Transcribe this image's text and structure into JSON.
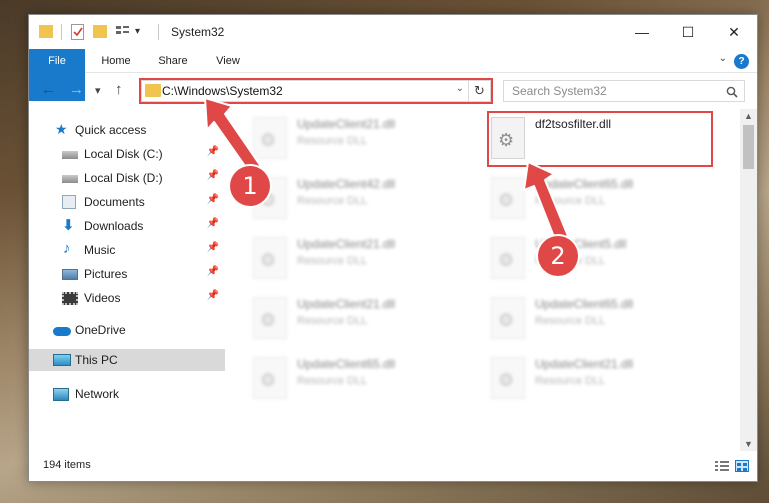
{
  "window": {
    "title": "System32",
    "controls": {
      "minimize": "—",
      "maximize": "☐",
      "close": "✕"
    }
  },
  "ribbon": {
    "tabs": [
      "File",
      "Home",
      "Share",
      "View"
    ],
    "help": "?"
  },
  "nav": {
    "back": "←",
    "forward": "→",
    "recent": "▾",
    "up": "↑"
  },
  "address": {
    "path": "C:\\Windows\\System32",
    "dropdown": "⌄",
    "refresh": "↻"
  },
  "search": {
    "placeholder": "Search System32",
    "icon": "search-icon"
  },
  "sidebar": {
    "items": [
      {
        "label": "Quick access",
        "icon": "star-icon"
      },
      {
        "label": "Local Disk (C:)",
        "icon": "drive-icon",
        "pinned": true
      },
      {
        "label": "Local Disk (D:)",
        "icon": "drive-icon",
        "pinned": true
      },
      {
        "label": "Documents",
        "icon": "documents-icon",
        "pinned": true
      },
      {
        "label": "Downloads",
        "icon": "download-icon",
        "pinned": true
      },
      {
        "label": "Music",
        "icon": "music-icon",
        "pinned": true
      },
      {
        "label": "Pictures",
        "icon": "pictures-icon",
        "pinned": true
      },
      {
        "label": "Videos",
        "icon": "videos-icon",
        "pinned": true
      },
      {
        "label": "OneDrive",
        "icon": "cloud-icon"
      },
      {
        "label": "This PC",
        "icon": "pc-icon",
        "selected": true
      },
      {
        "label": "Network",
        "icon": "network-icon"
      }
    ]
  },
  "files": [
    {
      "name": "UpdateClient21.dll",
      "type": "Resource DLL"
    },
    {
      "name": "df2tsosfilter.dll",
      "type": ""
    },
    {
      "name": "UpdateClient42.dll",
      "type": "Resource DLL"
    },
    {
      "name": "UpdateClient65.dll",
      "type": "Resource DLL"
    },
    {
      "name": "UpdateClient21.dll",
      "type": "Resource DLL"
    },
    {
      "name": "UpdateClient5.dll",
      "type": "Resource DLL"
    },
    {
      "name": "UpdateClient21.dll",
      "type": "Resource DLL"
    },
    {
      "name": "UpdateClient65.dll",
      "type": "Resource DLL"
    },
    {
      "name": "UpdateClient65.dll",
      "type": "Resource DLL"
    },
    {
      "name": "UpdateClient21.dll",
      "type": "Resource DLL"
    }
  ],
  "status": {
    "item_count": "194 items"
  },
  "annotations": {
    "step1": "1",
    "step2": "2",
    "color": "#e04848"
  },
  "colors": {
    "accent": "#1979ca",
    "folder": "#f1c34f"
  }
}
